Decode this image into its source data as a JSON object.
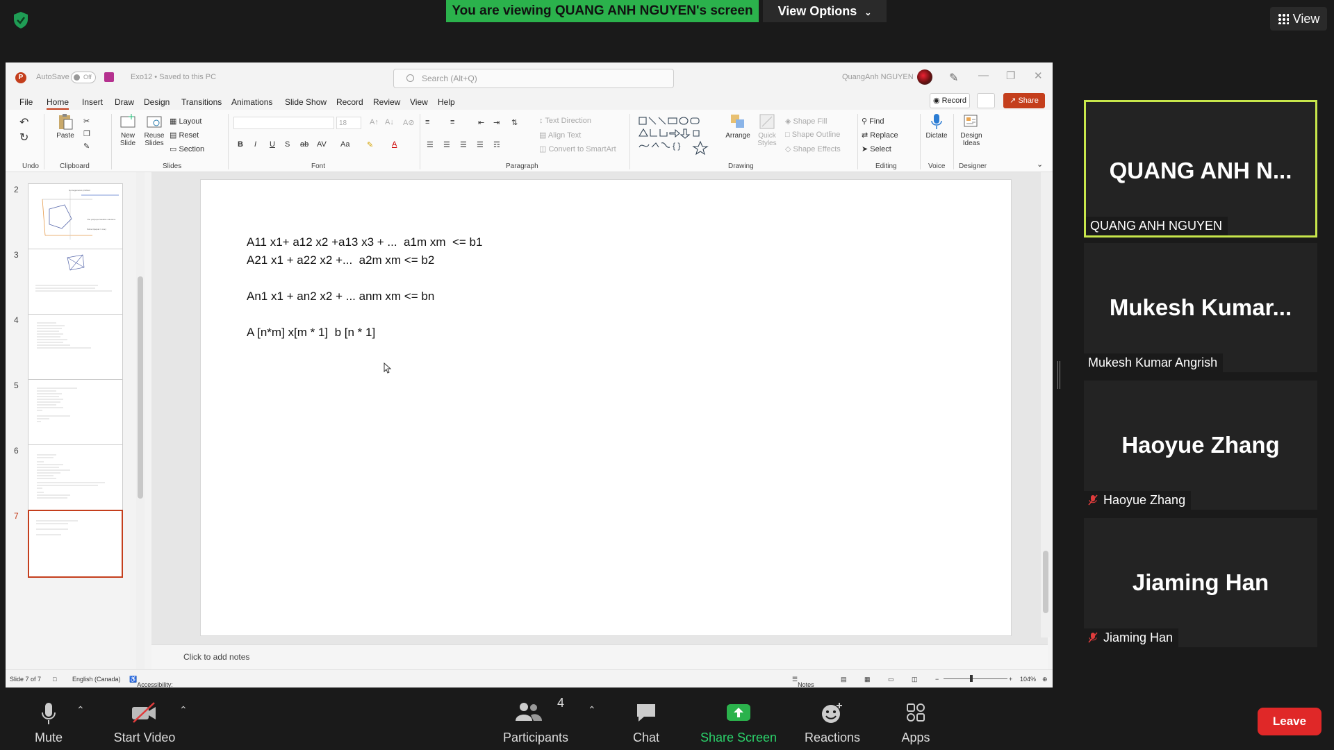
{
  "zoom": {
    "banner": "You are viewing QUANG ANH NGUYEN's screen",
    "view_options": "View Options",
    "view": "View",
    "toolbar": {
      "mute": "Mute",
      "start_video": "Start Video",
      "participants": "Participants",
      "participants_count": "4",
      "chat": "Chat",
      "share_screen": "Share Screen",
      "reactions": "Reactions",
      "apps": "Apps",
      "leave": "Leave"
    },
    "tiles": [
      {
        "big": "QUANG  ANH  N...",
        "name": "QUANG ANH NGUYEN"
      },
      {
        "big": "Mukesh  Kumar...",
        "name": "Mukesh Kumar Angrish"
      },
      {
        "big": "Haoyue Zhang",
        "name": "Haoyue Zhang"
      },
      {
        "big": "Jiaming Han",
        "name": "Jiaming Han"
      }
    ]
  },
  "ppt": {
    "autosave": "AutoSave",
    "autosave_state": "Off",
    "filename": "Exo12 • Saved to this PC",
    "search_placeholder": "Search (Alt+Q)",
    "username": "QuangAnh NGUYEN",
    "menu": [
      "File",
      "Home",
      "Insert",
      "Draw",
      "Design",
      "Transitions",
      "Animations",
      "Slide Show",
      "Record",
      "Review",
      "View",
      "Help"
    ],
    "record": "Record",
    "share": "Share",
    "ribbon": {
      "undo_group": "Undo",
      "clipboard_group": "Clipboard",
      "paste": "Paste",
      "slides_group": "Slides",
      "new_slide": "New Slide",
      "reuse_slides": "Reuse Slides",
      "layout": "Layout",
      "reset": "Reset",
      "section": "Section",
      "font_group": "Font",
      "font_size": "18",
      "paragraph_group": "Paragraph",
      "text_direction": "Text Direction",
      "align_text": "Align Text",
      "convert_smartart": "Convert to SmartArt",
      "drawing_group": "Drawing",
      "arrange": "Arrange",
      "quick_styles": "Quick Styles",
      "shape_fill": "Shape Fill",
      "shape_outline": "Shape Outline",
      "shape_effects": "Shape Effects",
      "editing_group": "Editing",
      "find": "Find",
      "replace": "Replace",
      "select": "Select",
      "voice_group": "Voice",
      "dictate": "Dictate",
      "designer_group": "Designer",
      "design_ideas": "Design Ideas"
    },
    "thumbnails": [
      "2",
      "3",
      "4",
      "5",
      "6",
      "7"
    ],
    "slide_lines": [
      "A11 x1+ a12 x2 +a13 x3 + ...  a1m xm  <= b1",
      "A21 x1 + a22 x2 +...  a2m xm <= b2",
      "An1 x1 + an2 x2 + ... anm xm <= bn",
      "A [n*m] x[m * 1]  b [n * 1]"
    ],
    "notes_placeholder": "Click to add notes",
    "status": {
      "slide": "Slide 7 of 7",
      "language": "English (Canada)",
      "accessibility": "Accessibility: Investigate",
      "notes": "Notes",
      "zoom": "104%"
    }
  }
}
